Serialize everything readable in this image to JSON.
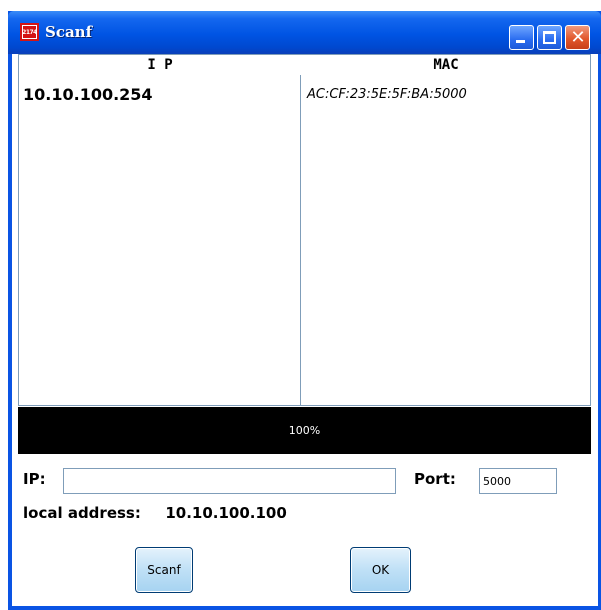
{
  "window": {
    "title": "Scanf",
    "icon": "app-logo-icon",
    "icon_text": "2174"
  },
  "table": {
    "columns": [
      "I P",
      "MAC"
    ],
    "rows": [
      {
        "ip": "10.10.100.254",
        "mac": "AC:CF:23:5E:5F:BA:5000"
      }
    ]
  },
  "progress": {
    "text": "100%",
    "value": 1.0
  },
  "form": {
    "ip_label": "IP:",
    "ip_value": "",
    "port_label": "Port:",
    "port_value": "5000",
    "local_address_label": "local address:",
    "local_address_value": "10.10.100.100"
  },
  "buttons": {
    "scanf": "Scanf",
    "ok": "OK"
  },
  "colors": {
    "titlebar": "#0054e3",
    "progress_bg": "#000000",
    "button_face": "#bfe0f6"
  }
}
